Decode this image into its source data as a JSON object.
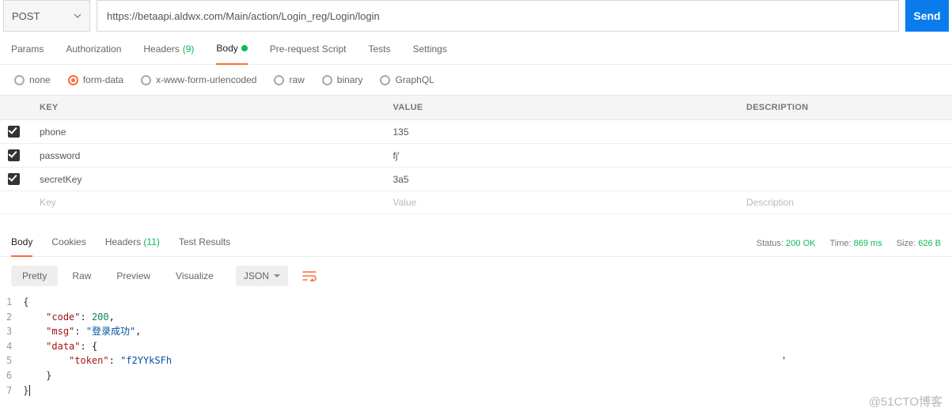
{
  "request": {
    "method": "POST",
    "url": "https://betaapi.aldwx.com/Main/action/Login_reg/Login/login",
    "send_label": "Send"
  },
  "tabs": [
    {
      "label": "Params"
    },
    {
      "label": "Authorization"
    },
    {
      "label": "Headers",
      "count": "(9)"
    },
    {
      "label": "Body",
      "dot": true,
      "active": true
    },
    {
      "label": "Pre-request Script"
    },
    {
      "label": "Tests"
    },
    {
      "label": "Settings"
    }
  ],
  "body_types": [
    {
      "label": "none"
    },
    {
      "label": "form-data",
      "on": true
    },
    {
      "label": "x-www-form-urlencoded"
    },
    {
      "label": "raw"
    },
    {
      "label": "binary"
    },
    {
      "label": "GraphQL"
    }
  ],
  "kv": {
    "headers": {
      "key": "KEY",
      "value": "VALUE",
      "desc": "DESCRIPTION"
    },
    "rows": [
      {
        "key": "phone",
        "value": "135"
      },
      {
        "key": "password",
        "value": "fj'"
      },
      {
        "key": "secretKey",
        "value": "3a5"
      }
    ],
    "placeholder": {
      "key": "Key",
      "value": "Value",
      "desc": "Description"
    }
  },
  "response": {
    "tabs": [
      {
        "label": "Body",
        "active": true
      },
      {
        "label": "Cookies"
      },
      {
        "label": "Headers",
        "count": "(11)"
      },
      {
        "label": "Test Results"
      }
    ],
    "status_label": "Status:",
    "status_value": "200 OK",
    "time_label": "Time:",
    "time_value": "869 ms",
    "size_label": "Size:",
    "size_value": "626 B",
    "views": [
      {
        "label": "Pretty",
        "active": true
      },
      {
        "label": "Raw"
      },
      {
        "label": "Preview"
      },
      {
        "label": "Visualize"
      }
    ],
    "format": "JSON",
    "json": {
      "l1": "{",
      "l2a": "\"code\"",
      "l2b": ": ",
      "l2c": "200",
      "l2d": ",",
      "l3a": "\"msg\"",
      "l3b": ": ",
      "l3c": "\"登录成功\"",
      "l3d": ",",
      "l4a": "\"data\"",
      "l4b": ": {",
      "l5a": "\"token\"",
      "l5b": ": ",
      "l5c": "\"f2YYkSFh",
      "l5d": "'",
      "l6": "}",
      "l7": "}"
    }
  },
  "watermark": "@51CTO博客"
}
